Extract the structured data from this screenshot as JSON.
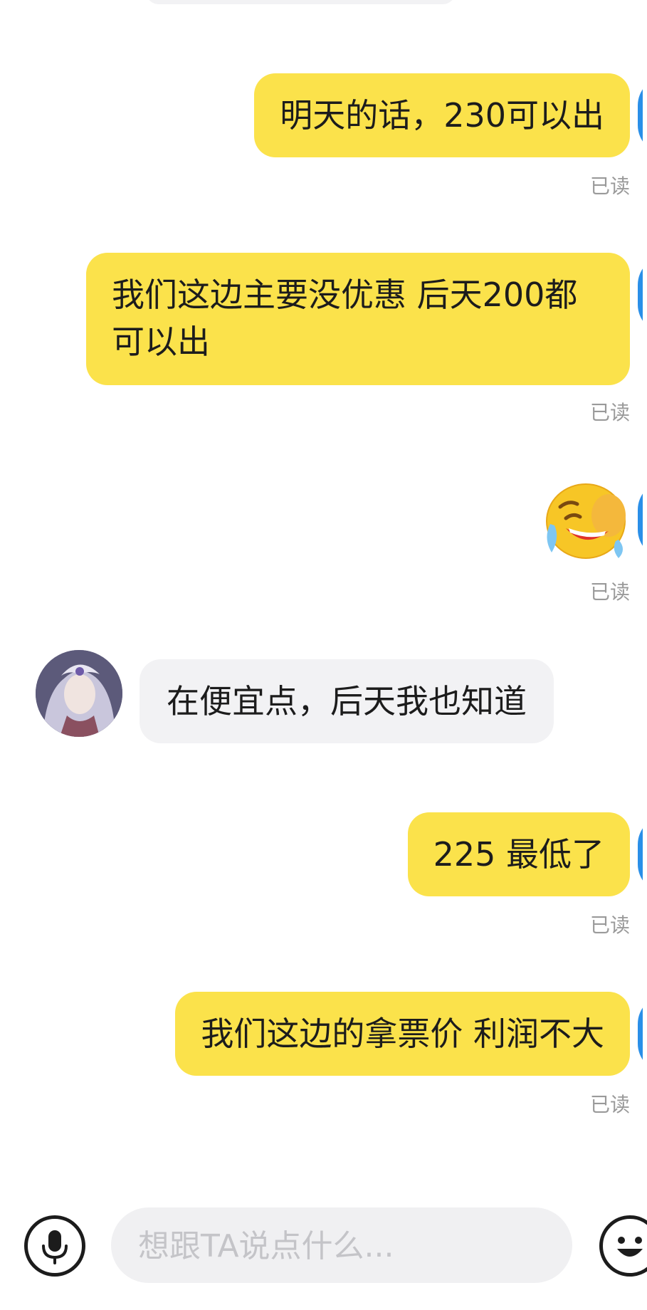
{
  "messages": [
    {
      "side": "self",
      "text": "明天的话，230可以出",
      "status": "已读"
    },
    {
      "side": "self",
      "text": "我们这边主要没优惠 后天200都可以出",
      "status": "已读"
    },
    {
      "side": "self",
      "emoji": "crying-laughing-emoji",
      "status": "已读"
    },
    {
      "side": "other",
      "text": "在便宜点，后天我也知道"
    },
    {
      "side": "self",
      "text": "225 最低了",
      "status": "已读"
    },
    {
      "side": "self",
      "text": "我们这边的拿票价 利润不大",
      "status": "已读"
    }
  ],
  "input": {
    "value": "",
    "placeholder": "想跟TA说点什么..."
  },
  "icons": {
    "voice": "microphone-icon",
    "emoji": "smiley-icon"
  },
  "colors": {
    "self_bubble": "#fbe24b",
    "other_bubble": "#f2f2f4",
    "read_status": "#9a9a9a"
  }
}
